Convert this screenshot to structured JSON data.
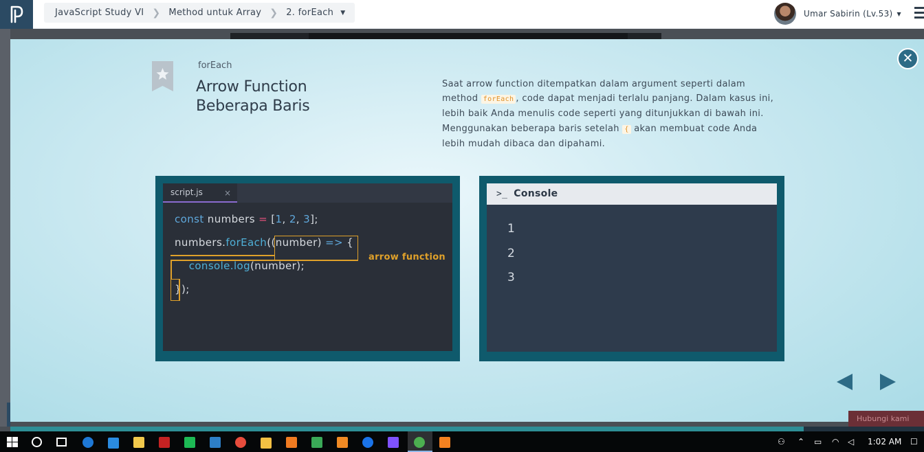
{
  "breadcrumb": {
    "course": "JavaScript Study VI",
    "chapter": "Method untuk Array",
    "lesson": "2. forEach"
  },
  "user": {
    "name": "Umar Sabirin (Lv.53)"
  },
  "slide": {
    "kicker": "forEach",
    "title_line1": "Arrow Function",
    "title_line2": "Beberapa Baris",
    "desc_part1": "Saat arrow function ditempatkan dalam argument seperti dalam method ",
    "desc_code1": "forEach",
    "desc_part2": ", code dapat menjadi terlalu panjang. Dalam kasus ini, lebih baik Anda menulis code seperti yang ditunjukkan di bawah ini. Menggunakan beberapa baris setelah ",
    "desc_code2": "{",
    "desc_part3": " akan membuat code Anda lebih mudah dibaca dan dipahami."
  },
  "editor": {
    "tab_name": "script.js",
    "tab_close": "×",
    "annotation": "arrow function",
    "code": {
      "l1_kw": "const",
      "l1_var": " numbers ",
      "l1_eq": "=",
      "l1_open": " [",
      "l1_n1": "1",
      "l1_c1": ", ",
      "l1_n2": "2",
      "l1_c2": ", ",
      "l1_n3": "3",
      "l1_close": "];",
      "l2_obj": "numbers.",
      "l2_fn": "forEach",
      "l2_args": "((number) ",
      "l2_arrow": "=>",
      "l2_brace": " {",
      "l3_fn": "console.log",
      "l3_args": "(number);",
      "l4": "});"
    }
  },
  "console": {
    "prompt": ">_",
    "title": "Console",
    "output": [
      "1",
      "2",
      "3"
    ]
  },
  "background": {
    "badge": "Hubungi kami"
  },
  "taskbar": {
    "time": "1:02 AM"
  },
  "colors": {
    "accent": "#2d6b86",
    "highlight": "#e0a12a",
    "panel_border": "#0f5a6c"
  }
}
